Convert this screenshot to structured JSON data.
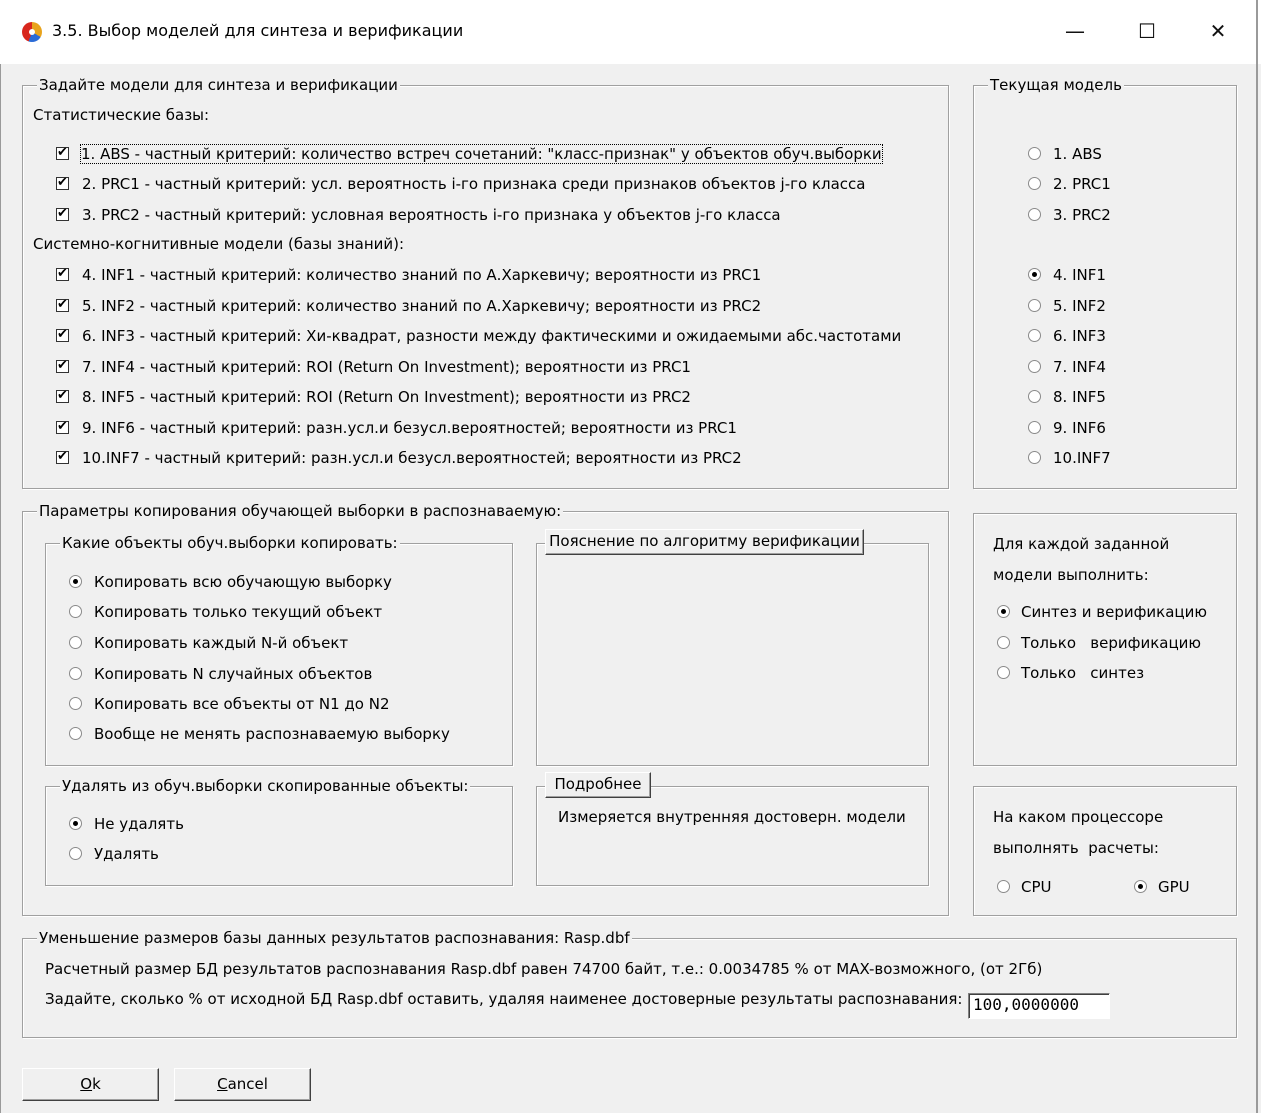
{
  "window": {
    "title": "3.5. Выбор моделей для синтеза и верификации",
    "minimize": "—",
    "maximize": "☐",
    "close": "✕"
  },
  "models_group": {
    "legend": "Задайте модели для синтеза и верификации",
    "stat_label": "Статистические базы:",
    "sys_label": "Системно-когнитивные модели (базы знаний):",
    "stat_items": [
      {
        "label": "1. ABS  - частный критерий: количество встреч сочетаний: \"класс-признак\" у объектов обуч.выборки",
        "checked": true
      },
      {
        "label": "2. PRC1 - частный критерий: усл. вероятность i-го признака среди признаков объектов j-го класса",
        "checked": true
      },
      {
        "label": "3. PRC2 - частный критерий: условная вероятность i-го признака у объектов j-го класса",
        "checked": true
      }
    ],
    "sys_items": [
      {
        "label": "4. INF1 - частный критерий: количество знаний по А.Харкевичу; вероятности из PRC1",
        "checked": true
      },
      {
        "label": "5. INF2 - частный критерий: количество знаний по А.Харкевичу; вероятности из PRC2",
        "checked": true
      },
      {
        "label": "6. INF3 - частный критерий: Хи-квадрат, разности между фактическими и ожидаемыми абс.частотами",
        "checked": true
      },
      {
        "label": "7. INF4 - частный критерий: ROI (Return On Investment); вероятности из PRC1",
        "checked": true
      },
      {
        "label": "8. INF5 - частный критерий: ROI (Return On Investment); вероятности из PRC2",
        "checked": true
      },
      {
        "label": "9. INF6 - частный критерий: разн.усл.и безусл.вероятностей; вероятности из PRC1",
        "checked": true
      },
      {
        "label": "10.INF7 - частный критерий: разн.усл.и безусл.вероятностей; вероятности из PRC2",
        "checked": true
      }
    ]
  },
  "current_model": {
    "legend": "Текущая модель",
    "options": [
      "1. ABS",
      "2. PRC1",
      "3. PRC2",
      "4. INF1",
      "5. INF2",
      "6. INF3",
      "7. INF4",
      "8. INF5",
      "9. INF6",
      "10.INF7"
    ],
    "selected": "4. INF1"
  },
  "copy_params": {
    "legend": "Параметры копирования обучающей выборки в распознаваемую:",
    "which_legend": "Какие объекты обуч.выборки копировать:",
    "which_options": [
      "Копировать всю обучающую выборку",
      "Копировать только текущий объект",
      "Копировать каждый N-й объект",
      "Копировать N случайных объектов",
      "Копировать все объекты от N1 до N2",
      "Вообще не менять распознаваемую выборку"
    ],
    "which_selected": "Копировать всю обучающую выборку",
    "delete_legend": "Удалять из обуч.выборки скопированные объекты:",
    "delete_options": [
      "Не удалять",
      "Удалять"
    ],
    "delete_selected": "Не удалять",
    "explain_button": "Пояснение по алгоритму верификации",
    "details_button": "Подробнее",
    "details_text": "Измеряется внутренняя достоверн. модели"
  },
  "action": {
    "line1": "Для каждой заданной",
    "line2": "модели выполнить:",
    "options": [
      "Синтез и верификацию",
      "Только   верификацию",
      "Только   синтез"
    ],
    "selected": "Синтез и верификацию"
  },
  "processor": {
    "line1": "На каком процессоре",
    "line2": "выполнять  расчеты:",
    "options": [
      "CPU",
      "GPU"
    ],
    "selected": "GPU"
  },
  "db_reduce": {
    "legend": "Уменьшение размеров базы данных результатов распознавания: Rasp.dbf",
    "info": "Расчетный размер БД результатов распознавания Rasp.dbf равен 74700 байт, т.е.: 0.0034785 % от MAX-возможного, (от 2Гб)",
    "prompt": "Задайте, сколько % от исходной БД Rasp.dbf оставить, удаляя наименее достоверные результаты распознавания:",
    "value": "100,0000000"
  },
  "buttons": {
    "ok_u": "O",
    "ok_rest": "k",
    "cancel_u": "C",
    "cancel_rest": "ancel"
  }
}
